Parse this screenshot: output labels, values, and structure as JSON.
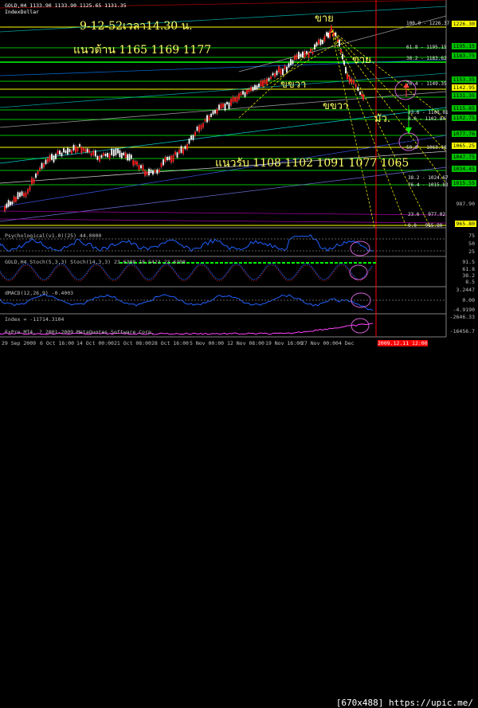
{
  "chart": {
    "symbol_line": "GOLD,H4  1133.90 1133.90 1125.65 1131.35",
    "indicator": "IndexDollar",
    "annotations": {
      "date_time": "9-12-52เวลา14.30 น.",
      "resistance": "แนวต้าน 1165  1169  1177",
      "support": "แนวรับ 1108  1102  1091  1077  1065",
      "sell1": "ขาย",
      "sell2": "ขาย",
      "swing1": "ขขวา",
      "swing2": "ขขวา",
      "word": "มัว."
    },
    "price_labels": [
      {
        "value": "1226.30",
        "bg": "#ffff00",
        "fg": "#000"
      },
      {
        "value": "1195.15",
        "bg": "#00c000",
        "fg": "#000"
      },
      {
        "value": "1183.75",
        "bg": "#00c000",
        "fg": "#000"
      },
      {
        "value": "1153.35",
        "bg": "#00c000",
        "fg": "#000"
      },
      {
        "value": "1142.95",
        "bg": "#ffff00",
        "fg": "#000"
      },
      {
        "value": "1131.35",
        "bg": "#00c000",
        "fg": "#000"
      },
      {
        "value": "1115.85",
        "bg": "#00c000",
        "fg": "#000"
      },
      {
        "value": "1102.75",
        "bg": "#00c000",
        "fg": "#000"
      },
      {
        "value": "1077.76",
        "bg": "#00c000",
        "fg": "#000"
      },
      {
        "value": "1065.25",
        "bg": "#ffff00",
        "fg": "#000"
      },
      {
        "value": "1047.75",
        "bg": "#00c000",
        "fg": "#000"
      },
      {
        "value": "1034.45",
        "bg": "#00c000",
        "fg": "#000"
      },
      {
        "value": "1015.55",
        "bg": "#00c000",
        "fg": "#000"
      },
      {
        "value": "987.90",
        "bg": "#000",
        "fg": "#c0c0c0"
      },
      {
        "value": "965.80",
        "bg": "#ffff00",
        "fg": "#000"
      }
    ],
    "fib_labels": [
      "100.0 - 1226.37",
      "61.8 - 1195.15",
      "38.2 - 1183.62",
      "76.4 - 1149.35",
      "23.6 - 1108.01",
      "0.0 - 1102.84",
      "50.0 - 1063.18",
      "38.2 - 1024.67",
      "76.4 - 1015.83",
      "23.6 - 977.02",
      "0.0 - 965.80"
    ],
    "indicators": [
      {
        "label": "Psychological(v1.0)(25) 44.0000",
        "scale": [
          "75",
          "50",
          "25"
        ]
      },
      {
        "label": "GOLD,H4 Stoch(5,3,3) Stoch(14,3,3) 23.6308 18.5423 23.6308",
        "scale": [
          "91.5",
          "61.8",
          "38.2",
          "8.5"
        ]
      },
      {
        "label": "dMACD(12,26,9) -0.4003",
        "scale": [
          "3.2447",
          "0.00",
          "-4.9190"
        ]
      },
      {
        "label": "Index = -11714.3104",
        "scale": [
          "-2646.33",
          "-16456.7"
        ]
      }
    ],
    "copyright": "FxPro MT4, ? 2001-2009 MetaQuotes Software Corp.",
    "time_labels": [
      "29 Sep 2009",
      "6 Oct 16:00",
      "14 Oct 00:00",
      "21 Oct 08:00",
      "28 Oct 16:00",
      "5 Nov 00:00",
      "12 Nov 08:00",
      "19 Nov 16:00",
      "27 Nov 00:00",
      "4 Dec",
      "2009.12.11 12:00"
    ],
    "watermark": "[670x488] https://upic.me/"
  }
}
